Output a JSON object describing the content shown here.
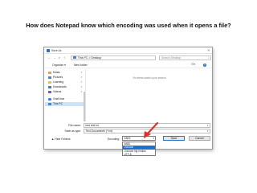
{
  "slide": {
    "title": "How does Notepad know which encoding was used when it opens a file?"
  },
  "dialog": {
    "title": "Save As",
    "address": {
      "segments": [
        "This PC",
        ">",
        "Desktop"
      ]
    },
    "search_placeholder": "Search Desktop",
    "toolbar": {
      "organize": "Organize ▾",
      "new_folder": "New folder"
    },
    "nav_items": [
      {
        "label": "Music",
        "icon": "music-icon",
        "color": "#e8a23a",
        "pinned": true
      },
      {
        "label": "Pictures",
        "icon": "pictures-icon",
        "color": "#4a84c6",
        "pinned": true
      },
      {
        "label": "Learning",
        "icon": "folder-icon",
        "color": "#e8c04a",
        "pinned": true
      },
      {
        "label": "Downloads",
        "icon": "downloads-icon",
        "color": "#3c7dd0",
        "pinned": true
      },
      {
        "label": "Videos",
        "icon": "videos-icon",
        "color": "#6a5bc2",
        "pinned": true
      },
      {
        "label": "OneDrive",
        "icon": "onedrive-icon",
        "color": "#2a7de1",
        "pinned": false
      },
      {
        "label": "This PC",
        "icon": "computer-icon",
        "color": "#4a84c6",
        "pinned": false
      }
    ],
    "empty_message": "No items match your search.",
    "file_name_label": "File name:",
    "file_name_value": "test text.txt",
    "save_type_label": "Save as type:",
    "save_type_value": "Text Documents (*.txt)",
    "hide_folders": "▲ Hide Folders",
    "encoding_label": "Encoding:",
    "encoding_selected": "ANSI",
    "encoding_options": [
      "ANSI",
      "Unicode",
      "Unicode big endian",
      "UTF-8"
    ],
    "encoding_highlighted_index": 1,
    "save_button": "Save",
    "cancel_button": "Cancel"
  },
  "colors": {
    "accent": "#1e6fd0",
    "arrow": "#d9342b"
  }
}
